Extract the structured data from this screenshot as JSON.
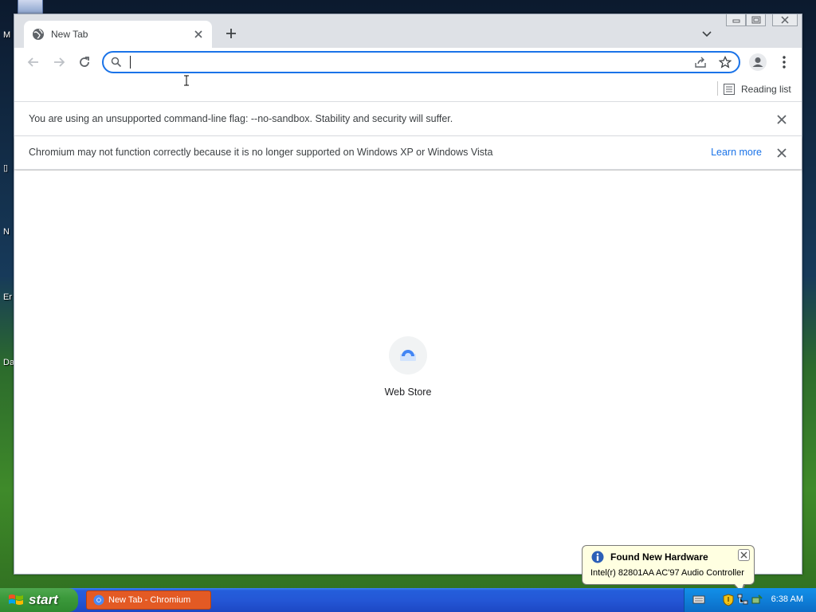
{
  "desktop": {
    "icon_labels": [
      "M",
      "N",
      "Er",
      "Da"
    ]
  },
  "browser": {
    "tab": {
      "title": "New Tab"
    },
    "omnibox": {
      "value": "",
      "placeholder": ""
    },
    "bookmarks": {
      "reading_list_label": "Reading list"
    },
    "infobars": [
      {
        "message": "You are using an unsupported command-line flag: --no-sandbox. Stability and security will suffer."
      },
      {
        "message": "Chromium may not function correctly because it is no longer supported on Windows XP or Windows Vista",
        "link": "Learn more"
      }
    ],
    "ntp": {
      "shortcuts": [
        {
          "label": "Web Store"
        }
      ]
    }
  },
  "balloon": {
    "title": "Found New Hardware",
    "text": "Intel(r) 82801AA AC'97 Audio Controller"
  },
  "taskbar": {
    "start_label": "start",
    "task_button_label": "New Tab - Chromium",
    "clock": "6:38 AM"
  },
  "colors": {
    "accent": "#1a73e8",
    "taskbar": "#245edb",
    "start": "#3c9a3c",
    "balloon": "#ffffe1"
  }
}
